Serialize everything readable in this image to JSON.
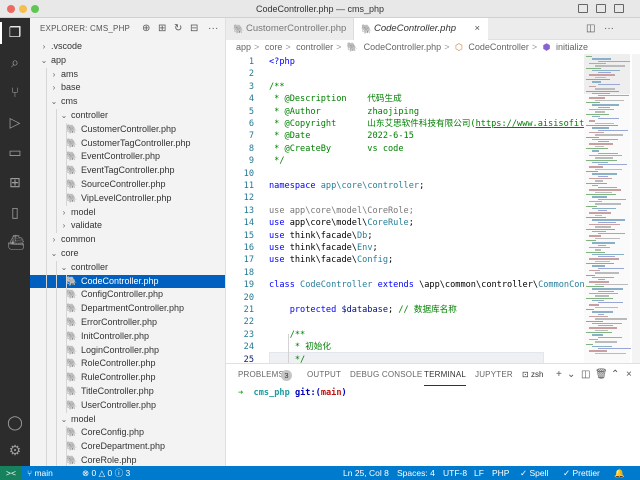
{
  "window": {
    "title": "CodeController.php — cms_php"
  },
  "activity_bar": [
    "files-icon",
    "search-icon",
    "source-control-icon",
    "run-debug-icon",
    "remote-explorer-icon",
    "extensions-icon",
    "testing-icon",
    "docker-icon",
    "account-icon",
    "settings-gear-icon"
  ],
  "explorer": {
    "title": "EXPLORER: CMS_PHP",
    "tree": [
      {
        "label": ".vscode",
        "depth": 0,
        "type": "folder",
        "open": false
      },
      {
        "label": "app",
        "depth": 0,
        "type": "folder",
        "open": true
      },
      {
        "label": "ams",
        "depth": 1,
        "type": "folder",
        "open": false
      },
      {
        "label": "base",
        "depth": 1,
        "type": "folder",
        "open": false
      },
      {
        "label": "cms",
        "depth": 1,
        "type": "folder",
        "open": true
      },
      {
        "label": "controller",
        "depth": 2,
        "type": "folder",
        "open": true
      },
      {
        "label": "CustomerController.php",
        "depth": 3,
        "type": "php"
      },
      {
        "label": "CustomerTagController.php",
        "depth": 3,
        "type": "php"
      },
      {
        "label": "EventController.php",
        "depth": 3,
        "type": "php"
      },
      {
        "label": "EventTagController.php",
        "depth": 3,
        "type": "php"
      },
      {
        "label": "SourceController.php",
        "depth": 3,
        "type": "php"
      },
      {
        "label": "VipLevelController.php",
        "depth": 3,
        "type": "php"
      },
      {
        "label": "model",
        "depth": 2,
        "type": "folder",
        "open": false
      },
      {
        "label": "validate",
        "depth": 2,
        "type": "folder",
        "open": false
      },
      {
        "label": "common",
        "depth": 1,
        "type": "folder",
        "open": false
      },
      {
        "label": "core",
        "depth": 1,
        "type": "folder",
        "open": true
      },
      {
        "label": "controller",
        "depth": 2,
        "type": "folder",
        "open": true
      },
      {
        "label": "CodeController.php",
        "depth": 3,
        "type": "php",
        "selected": true
      },
      {
        "label": "ConfigController.php",
        "depth": 3,
        "type": "php"
      },
      {
        "label": "DepartmentController.php",
        "depth": 3,
        "type": "php"
      },
      {
        "label": "ErrorController.php",
        "depth": 3,
        "type": "php"
      },
      {
        "label": "InitController.php",
        "depth": 3,
        "type": "php"
      },
      {
        "label": "LoginController.php",
        "depth": 3,
        "type": "php"
      },
      {
        "label": "RoleController.php",
        "depth": 3,
        "type": "php"
      },
      {
        "label": "RuleController.php",
        "depth": 3,
        "type": "php"
      },
      {
        "label": "TitleController.php",
        "depth": 3,
        "type": "php"
      },
      {
        "label": "UserController.php",
        "depth": 3,
        "type": "php"
      },
      {
        "label": "model",
        "depth": 2,
        "type": "folder",
        "open": true
      },
      {
        "label": "CoreConfig.php",
        "depth": 3,
        "type": "php"
      },
      {
        "label": "CoreDepartment.php",
        "depth": 3,
        "type": "php"
      },
      {
        "label": "CoreRole.php",
        "depth": 3,
        "type": "php"
      }
    ]
  },
  "tabs": [
    {
      "label": "CustomerController.php",
      "active": false
    },
    {
      "label": "CodeController.php",
      "active": true,
      "close": "×"
    }
  ],
  "breadcrumb": {
    "parts": [
      "app",
      "core",
      "controller",
      "CodeController.php",
      "CodeController",
      "initialize"
    ],
    "sep": ">"
  },
  "editor": {
    "lines": [
      {
        "n": "1",
        "tokens": [
          [
            "<?php",
            "k"
          ]
        ]
      },
      {
        "n": "2",
        "tokens": []
      },
      {
        "n": "3",
        "tokens": [
          [
            "/**",
            "c"
          ]
        ]
      },
      {
        "n": "4",
        "tokens": [
          [
            " * @Description    代码生成",
            "c"
          ]
        ]
      },
      {
        "n": "5",
        "tokens": [
          [
            " * @Author         zhaojiping",
            "c"
          ]
        ]
      },
      {
        "n": "6",
        "tokens": [
          [
            " * @Copyright      山东艾思软件科技有限公司(",
            "c"
          ],
          [
            "https://www.aisisofit.cn",
            "l"
          ],
          [
            ")",
            "c"
          ]
        ]
      },
      {
        "n": "7",
        "tokens": [
          [
            " * @Date           2022-6-15",
            "c"
          ]
        ]
      },
      {
        "n": "8",
        "tokens": [
          [
            " * @CreateBy       vs code",
            "c"
          ]
        ]
      },
      {
        "n": "9",
        "tokens": [
          [
            " */",
            "c"
          ]
        ]
      },
      {
        "n": "10",
        "tokens": []
      },
      {
        "n": "11",
        "tokens": [
          [
            "namespace ",
            "k"
          ],
          [
            "app\\core\\controller",
            "t"
          ],
          [
            ";",
            "p"
          ]
        ]
      },
      {
        "n": "12",
        "tokens": []
      },
      {
        "n": "13",
        "tokens": [
          [
            "use app\\core\\model\\CoreRole;",
            "d"
          ]
        ]
      },
      {
        "n": "14",
        "tokens": [
          [
            "use ",
            "k"
          ],
          [
            "app\\core\\model\\",
            "p"
          ],
          [
            "CoreRule",
            "t"
          ],
          [
            ";",
            "p"
          ]
        ]
      },
      {
        "n": "15",
        "tokens": [
          [
            "use ",
            "k"
          ],
          [
            "think\\facade\\",
            "p"
          ],
          [
            "Db",
            "t"
          ],
          [
            ";",
            "p"
          ]
        ]
      },
      {
        "n": "16",
        "tokens": [
          [
            "use ",
            "k"
          ],
          [
            "think\\facade\\",
            "p"
          ],
          [
            "Env",
            "t"
          ],
          [
            ";",
            "p"
          ]
        ]
      },
      {
        "n": "17",
        "tokens": [
          [
            "use ",
            "k"
          ],
          [
            "think\\facade\\",
            "p"
          ],
          [
            "Config",
            "t"
          ],
          [
            ";",
            "p"
          ]
        ]
      },
      {
        "n": "18",
        "tokens": []
      },
      {
        "n": "19",
        "tokens": [
          [
            "class ",
            "k"
          ],
          [
            "CodeController",
            "t"
          ],
          [
            " extends ",
            "k"
          ],
          [
            "\\app\\common\\controller\\",
            "p"
          ],
          [
            "CommonControll",
            "t"
          ]
        ]
      },
      {
        "n": "20",
        "tokens": []
      },
      {
        "n": "21",
        "tokens": [
          [
            "    protected ",
            "k"
          ],
          [
            "$database",
            "v"
          ],
          [
            "; ",
            "p"
          ],
          [
            "// 数据库名称",
            "c"
          ]
        ]
      },
      {
        "n": "22",
        "tokens": []
      },
      {
        "n": "23",
        "tokens": [
          [
            "    /**",
            "c"
          ]
        ]
      },
      {
        "n": "24",
        "tokens": [
          [
            "     * 初始化",
            "c"
          ]
        ]
      },
      {
        "n": "25",
        "tokens": [
          [
            "     */",
            "c"
          ]
        ],
        "current": true
      }
    ]
  },
  "panel": {
    "tabs": [
      "PROBLEMS",
      "OUTPUT",
      "DEBUG CONSOLE",
      "TERMINAL",
      "JUPYTER"
    ],
    "active_tab": "TERMINAL",
    "problems_count": "3",
    "shell": "zsh",
    "terminal": {
      "arrow": "➜",
      "dir": "cms_php",
      "git": "git:(",
      "branch": "main",
      "git_close": ")"
    }
  },
  "status_bar": {
    "remote": "><",
    "branch": "main",
    "errors": "0",
    "warnings": "0",
    "info": "3",
    "position": "Ln 25, Col 8",
    "spaces": "Spaces: 4",
    "encoding": "UTF-8",
    "eol": "LF",
    "language": "PHP",
    "spell": "✓ Spell",
    "prettier": "✓ Prettier"
  },
  "colors": {
    "accent": "#007acc",
    "selection": "#0060c0",
    "remote": "#16825d"
  }
}
